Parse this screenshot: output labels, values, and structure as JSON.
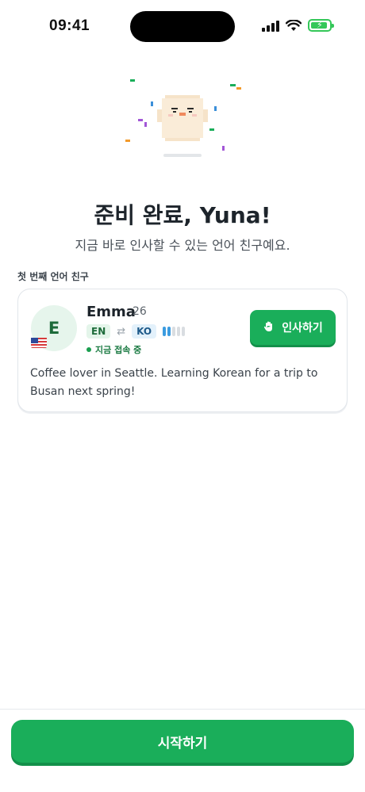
{
  "status_bar": {
    "time": "09:41",
    "icons": [
      "signal-icon",
      "wifi-icon",
      "battery-charging-icon"
    ]
  },
  "colors": {
    "accent": "#1aae5a",
    "accent_shadow": "#13904a",
    "text_primary": "#1d242b",
    "online": "#1a9e4f"
  },
  "hero": {
    "mascot": "pixel-mascot-illustration",
    "title": "준비 완료, Yuna!",
    "subtitle": "지금 바로 인사할 수 있는 언어 친구예요."
  },
  "friends_section": {
    "label": "첫 번째 언어 친구",
    "friend": {
      "avatar_initial": "E",
      "flag": "us-flag-icon",
      "name": "Emma",
      "age": "26",
      "native_language": "EN",
      "learning_language": "KO",
      "learning_level": 0.4,
      "status": "지금 접속 중",
      "greet_label": "인사하기",
      "greet_icon": "waving-hand-icon",
      "bio": "Coffee lover in Seattle. Learning Korean for a trip to Busan next spring!"
    }
  },
  "footer": {
    "start_label": "시작하기"
  }
}
